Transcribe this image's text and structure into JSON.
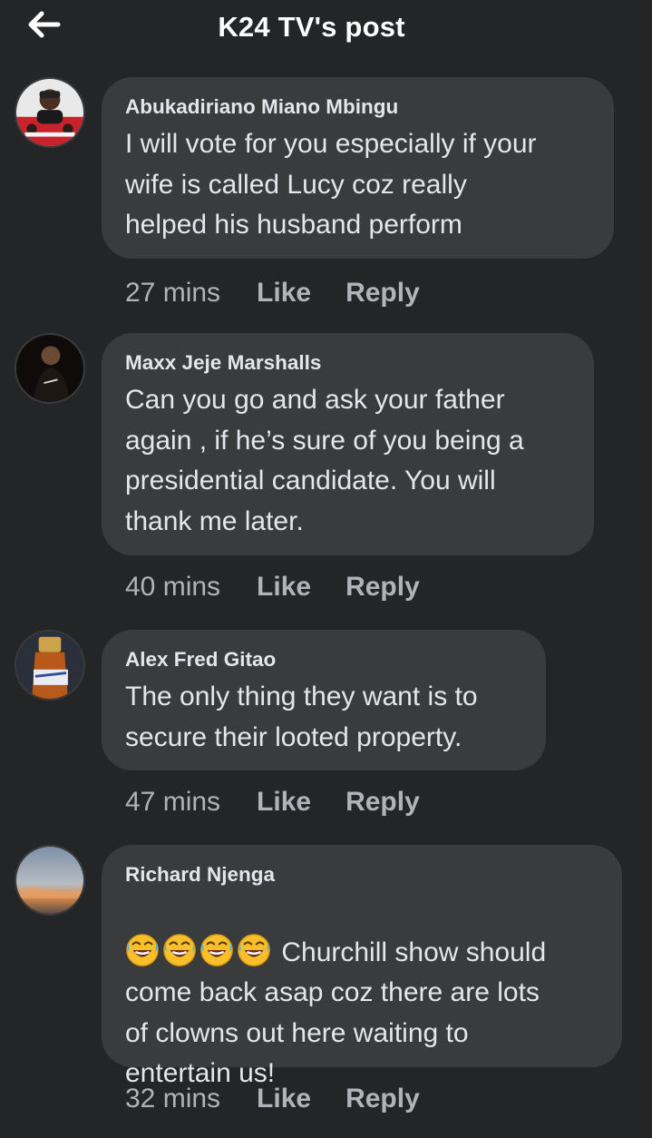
{
  "header": {
    "title": "K24 TV's post",
    "back_icon": "arrow-left-icon"
  },
  "comments": [
    {
      "author": "Abukadiriano Miano Mbingu",
      "text": "I will vote for you especially if your\nwife is called  Lucy coz really\nhelped his husband perform",
      "time": "27 mins",
      "like": "Like",
      "reply": "Reply"
    },
    {
      "author": "Maxx Jeje Marshalls",
      "text": "Can you go and ask your father\nagain , if he’s sure of you being a\npresidential candidate. You will\nthank me later.",
      "time": "40 mins",
      "like": "Like",
      "reply": "Reply"
    },
    {
      "author": "Alex Fred Gitao",
      "text": "The only thing they want is to\nsecure their looted property.",
      "time": "47 mins",
      "like": "Like",
      "reply": "Reply"
    },
    {
      "author": "Richard Njenga",
      "text_first_line": "Churchill show should",
      "text_rest": "come back asap coz there are lots\nof clowns out here waiting to\nentertain us!",
      "emoji_icon": "rolling-on-floor-laughing-icon",
      "emoji_count": 4,
      "time": "32 mins",
      "like": "Like",
      "reply": "Reply"
    }
  ],
  "colors": {
    "background": "#242526",
    "bubble": "#3a3b3c",
    "primary_text": "#e4e6eb",
    "secondary_text": "#b0b3b8"
  }
}
